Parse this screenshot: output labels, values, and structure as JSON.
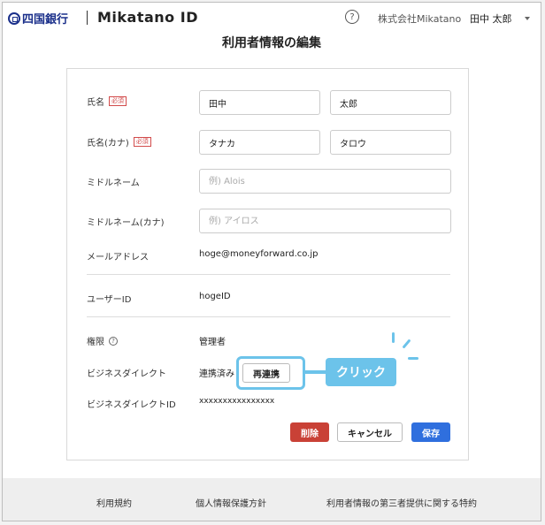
{
  "header": {
    "bank_name": "四国銀行",
    "brand": "Mikatano ID",
    "help": "?",
    "company": "株式会社Mikatano",
    "user": "田中 太郎"
  },
  "page_title": "利用者情報の編集",
  "form": {
    "required_badge": "必須",
    "name_label": "氏名",
    "last_name": "田中",
    "first_name": "太郎",
    "kana_label": "氏名(カナ)",
    "last_name_kana": "タナカ",
    "first_name_kana": "タロウ",
    "middle_label": "ミドルネーム",
    "middle_placeholder": "例) Alois",
    "middle_kana_label": "ミドルネーム(カナ)",
    "middle_kana_placeholder": "例) アイロス",
    "email_label": "メールアドレス",
    "email": "hoge@moneyforward.co.jp",
    "userid_label": "ユーザーID",
    "userid": "hogeID",
    "role_label": "権限",
    "role": "管理者",
    "bizdirect_label": "ビジネスダイレクト",
    "bizdirect_status": "連携済み",
    "reconnect_button": "再連携",
    "bizdirect_id_label": "ビジネスダイレクトID",
    "bizdirect_id": "xxxxxxxxxxxxxxxx"
  },
  "annotation": {
    "click_label": "クリック"
  },
  "actions": {
    "delete": "削除",
    "cancel": "キャンセル",
    "save": "保存"
  },
  "footer": {
    "terms": "利用規約",
    "privacy": "個人情報保護方針",
    "third_party": "利用者情報の第三者提供に関する特約"
  },
  "colors": {
    "accent": "#2f6fde",
    "danger": "#c94136",
    "annotation": "#6cc3ea",
    "bank": "#1a2f8a"
  }
}
